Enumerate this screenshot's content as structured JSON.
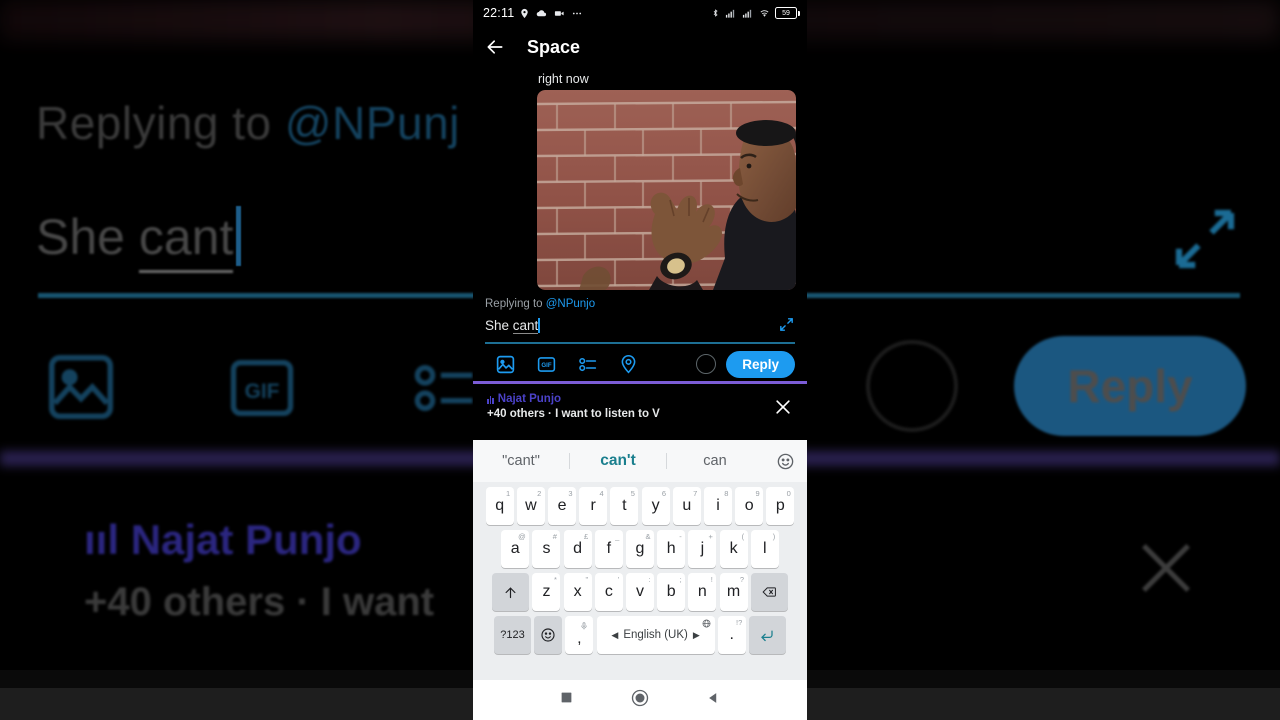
{
  "statusbar": {
    "time": "22:11",
    "left_icons": [
      "location-icon",
      "cloud-icon",
      "video-camera-icon",
      "more-dots-icon"
    ],
    "right_icons": [
      "bluetooth-icon",
      "signal-1-icon",
      "signal-2-icon",
      "wifi-icon"
    ],
    "battery_level": "59"
  },
  "appbar": {
    "back_icon": "back-arrow-icon",
    "title": "Space"
  },
  "content": {
    "above_text": "right now",
    "media_type": "gif"
  },
  "compose": {
    "reply_to_prefix": "Replying to ",
    "reply_to_handle": "@NPunjo",
    "text_plain": "She ",
    "text_misspelled": "cant",
    "expand_icon": "expand-arrows-icon",
    "toolbar_icons": [
      "image-icon",
      "gif-icon",
      "poll-icon",
      "location-pin-icon"
    ],
    "counter_label": "",
    "reply_label": "Reply",
    "accent_color": "#1d9bf0",
    "underline_color": "#7b5cd6"
  },
  "space_banner": {
    "audio_icon": "audio-bars-icon",
    "name": "Najat Punjo",
    "subtitle": "+40 others · I want to listen to V",
    "close_icon": "close-icon",
    "name_color": "#4b42c9"
  },
  "keyboard": {
    "suggestions": [
      {
        "label": "\"cant\"",
        "active": false
      },
      {
        "label": "can't",
        "active": true
      },
      {
        "label": "can",
        "active": false
      }
    ],
    "emoji_icon": "emoji-smiley-icon",
    "row1": [
      {
        "key": "q",
        "sup": "1"
      },
      {
        "key": "w",
        "sup": "2"
      },
      {
        "key": "e",
        "sup": "3"
      },
      {
        "key": "r",
        "sup": "4"
      },
      {
        "key": "t",
        "sup": "5"
      },
      {
        "key": "y",
        "sup": "6"
      },
      {
        "key": "u",
        "sup": "7"
      },
      {
        "key": "i",
        "sup": "8"
      },
      {
        "key": "o",
        "sup": "9"
      },
      {
        "key": "p",
        "sup": "0"
      }
    ],
    "row2": [
      {
        "key": "a",
        "sup": "@"
      },
      {
        "key": "s",
        "sup": "#"
      },
      {
        "key": "d",
        "sup": "£"
      },
      {
        "key": "f",
        "sup": "_"
      },
      {
        "key": "g",
        "sup": "&"
      },
      {
        "key": "h",
        "sup": "-"
      },
      {
        "key": "j",
        "sup": "+"
      },
      {
        "key": "k",
        "sup": "("
      },
      {
        "key": "l",
        "sup": ")"
      }
    ],
    "row3": [
      {
        "key": "z",
        "sup": "*"
      },
      {
        "key": "x",
        "sup": "\""
      },
      {
        "key": "c",
        "sup": "'"
      },
      {
        "key": "v",
        "sup": ":"
      },
      {
        "key": "b",
        "sup": ";"
      },
      {
        "key": "n",
        "sup": "!"
      },
      {
        "key": "m",
        "sup": "?"
      }
    ],
    "shift_icon": "shift-arrow-icon",
    "backspace_icon": "backspace-icon",
    "symbols_label": "?123",
    "emoji_key_icon": "emoji-key-icon",
    "comma_key": ",",
    "comma_sup_icon": "microphone-icon",
    "space_label": "English (UK)",
    "space_globe_icon": "globe-icon",
    "period_key": ".",
    "period_sup": "!?",
    "enter_icon": "enter-arrow-icon"
  },
  "navbar": {
    "recents_icon": "square-recents-icon",
    "home_icon": "circle-home-icon",
    "back_icon": "triangle-back-icon"
  },
  "background": {
    "reply_to_prefix": "Replying to ",
    "reply_to_handle": "@NPunj",
    "text_plain": "She ",
    "text_misspelled": "cant",
    "reply_label": "Reply",
    "name": "Najat Punjo",
    "subtitle": "+40 others · I want",
    "gif_label": "GIF"
  }
}
